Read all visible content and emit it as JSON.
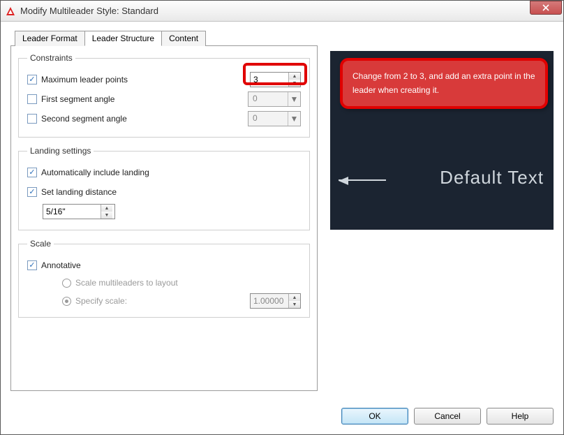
{
  "window": {
    "title": "Modify Multileader Style: Standard"
  },
  "tabs": {
    "leader_format": "Leader Format",
    "leader_structure": "Leader Structure",
    "content": "Content"
  },
  "constraints": {
    "legend": "Constraints",
    "max_leader_points_label": "Maximum leader points",
    "max_leader_points_value": "3",
    "first_segment_angle_label": "First segment angle",
    "first_segment_angle_value": "0",
    "second_segment_angle_label": "Second segment angle",
    "second_segment_angle_value": "0"
  },
  "landing": {
    "legend": "Landing settings",
    "auto_include_label": "Automatically include landing",
    "set_distance_label": "Set landing distance",
    "distance_value": "5/16\""
  },
  "scale": {
    "legend": "Scale",
    "annotative_label": "Annotative",
    "scale_to_layout_label": "Scale multileaders to layout",
    "specify_scale_label": "Specify scale:",
    "specify_scale_value": "1.00000"
  },
  "preview": {
    "text": "Default Text"
  },
  "callout": {
    "text": "Change from 2 to 3, and add an extra point in the leader when creating it."
  },
  "buttons": {
    "ok": "OK",
    "cancel": "Cancel",
    "help": "Help"
  }
}
